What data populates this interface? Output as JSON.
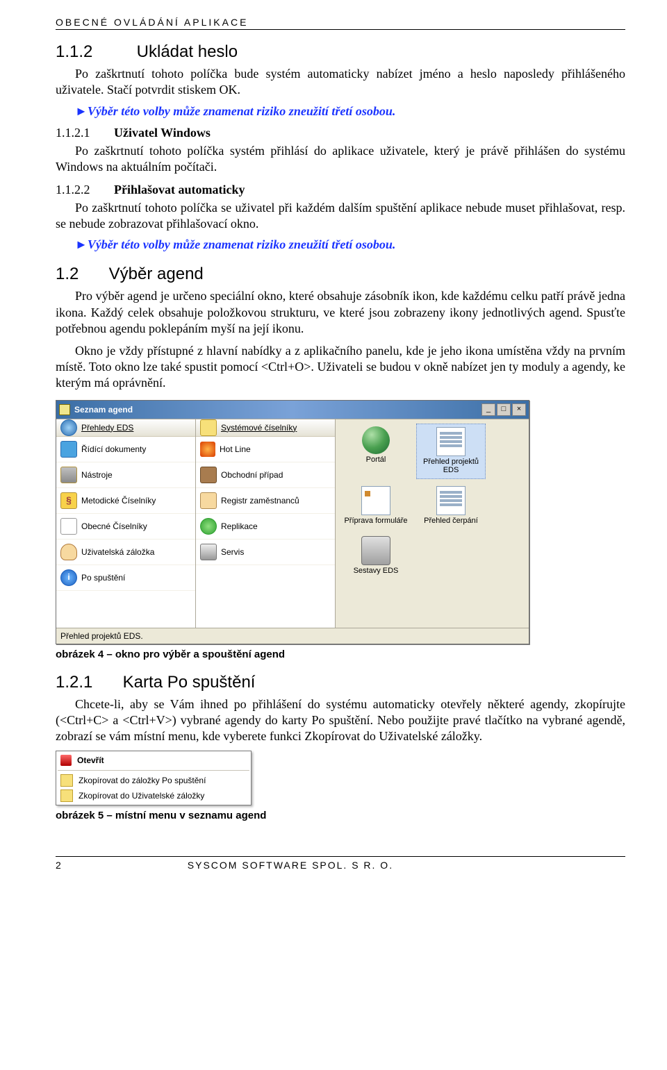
{
  "header": "OBECNÉ OVLÁDÁNÍ APLIKACE",
  "s112": {
    "num": "1.1.2",
    "title": "Ukládat heslo",
    "p": "Po zaškrtnutí tohoto políčka bude systém automaticky nabízet jméno a heslo naposledy přihlášeného uživatele. Stačí potvrdit stiskem OK.",
    "warn": "►Výběr této volby může znamenat riziko zneužití třetí osobou."
  },
  "s1121": {
    "num": "1.1.2.1",
    "title": "Uživatel Windows",
    "p": "Po zaškrtnutí tohoto políčka systém přihlásí do aplikace uživatele, který je právě přihlášen do systému Windows na aktuálním počítači."
  },
  "s1122": {
    "num": "1.1.2.2",
    "title": "Přihlašovat automaticky",
    "p": "Po zaškrtnutí tohoto políčka se uživatel při každém dalším spuštění aplikace nebude muset přihlašovat, resp. se nebude zobrazovat přihlašovací okno.",
    "warn": "►Výběr této volby může znamenat riziko zneužití třetí osobou."
  },
  "s12": {
    "num": "1.2",
    "title": "Výběr agend",
    "p1": "Pro výběr agend je určeno speciální okno, které obsahuje zásobník ikon, kde každému celku patří právě jedna ikona. Každý celek obsahuje položkovou strukturu, ve které jsou zobrazeny ikony jednotlivých agend. Spusťte potřebnou agendu poklepáním myší na její ikonu.",
    "p2": "Okno je vždy přístupné z hlavní nabídky a z aplikačního panelu, kde je jeho ikona umístěna vždy na prvním místě. Toto okno lze také spustit pomocí <Ctrl+O>. Uživateli se budou v okně nabízet jen ty moduly a agendy, ke kterým má oprávnění."
  },
  "caption4": "obrázek 4 – okno pro výběr a spouštění agend",
  "s121": {
    "num": "1.2.1",
    "title": "Karta Po spuštění",
    "p": "Chcete-li, aby se Vám ihned po přihlášení do systému automaticky otevřely některé agendy, zkopírujte (<Ctrl+C> a <Ctrl+V>) vybrané agendy do karty Po spuštění. Nebo použijte pravé tlačítko na vybrané agendě, zobrazí se vám místní menu, kde vyberete funkci Zkopírovat do Uživatelské záložky."
  },
  "caption5": "obrázek 5 – místní menu v seznamu agend",
  "window": {
    "title": "Seznam agend",
    "btn_min": "_",
    "btn_max": "□",
    "btn_close": "×",
    "colA_header": "Přehledy EDS",
    "colA": [
      "Řídící dokumenty",
      "Nástroje",
      "Metodické Číselníky",
      "Obecné Číselníky",
      "Uživatelská záložka",
      "Po spuštění"
    ],
    "colB_header": "Systémové číselníky",
    "colB": [
      "Hot Line",
      "Obchodní případ",
      "Registr zaměstnanců",
      "Replikace",
      "Servis"
    ],
    "tiles": [
      {
        "label": "Portál"
      },
      {
        "label": "Přehled projektů EDS"
      },
      {
        "label": "Příprava formuláře"
      },
      {
        "label": "Přehled čerpání"
      },
      {
        "label": "Sestavy EDS"
      }
    ],
    "status": "Přehled projektů EDS."
  },
  "ctx": {
    "open": "Otevřít",
    "copy1": "Zkopírovat do záložky Po spuštění",
    "copy2": "Zkopírovat do Uživatelské záložky"
  },
  "footer": {
    "page": "2",
    "text": "SYSCOM SOFTWARE SPOL. S R. O."
  }
}
